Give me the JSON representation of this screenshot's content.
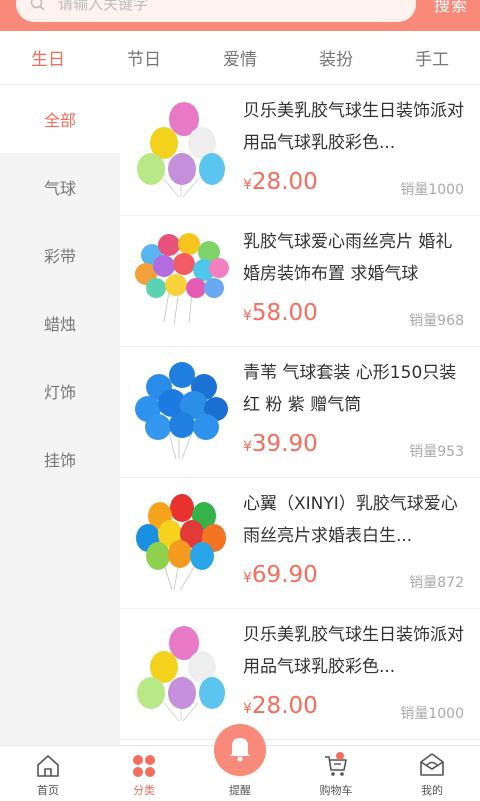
{
  "search": {
    "placeholder": "请输入关键字",
    "button": "搜索"
  },
  "tabs": [
    "生日",
    "节日",
    "爱情",
    "装扮",
    "手工"
  ],
  "sidebar": [
    "全部",
    "气球",
    "彩带",
    "蜡烛",
    "灯饰",
    "挂饰"
  ],
  "products": [
    {
      "title": "贝乐美乳胶气球生日装饰派对用品气球乳胶彩色...",
      "currency": "¥",
      "price": "28.00",
      "sales": "销量1000",
      "thumb": "pastel-balloons"
    },
    {
      "title": "乳胶气球爱心雨丝亮片 婚礼婚房装饰布置 求婚气球",
      "currency": "¥",
      "price": "58.00",
      "sales": "销量968",
      "thumb": "heart-balloons"
    },
    {
      "title": "青苇 气球套装 心形150只装 红 粉 紫 赠气筒",
      "currency": "¥",
      "price": "39.90",
      "sales": "销量953",
      "thumb": "blue-balloons"
    },
    {
      "title": "心翼（XINYI）乳胶气球爱心雨丝亮片求婚表白生...",
      "currency": "¥",
      "price": "69.90",
      "sales": "销量872",
      "thumb": "colorful-balloons"
    },
    {
      "title": "贝乐美乳胶气球生日装饰派对用品气球乳胶彩色...",
      "currency": "¥",
      "price": "28.00",
      "sales": "销量1000",
      "thumb": "pastel-balloons"
    }
  ],
  "bottom_nav": [
    "首页",
    "分类",
    "提醒",
    "购物车",
    "我的"
  ],
  "colors": {
    "accent": "#f76c5a",
    "header": "#f98978"
  }
}
